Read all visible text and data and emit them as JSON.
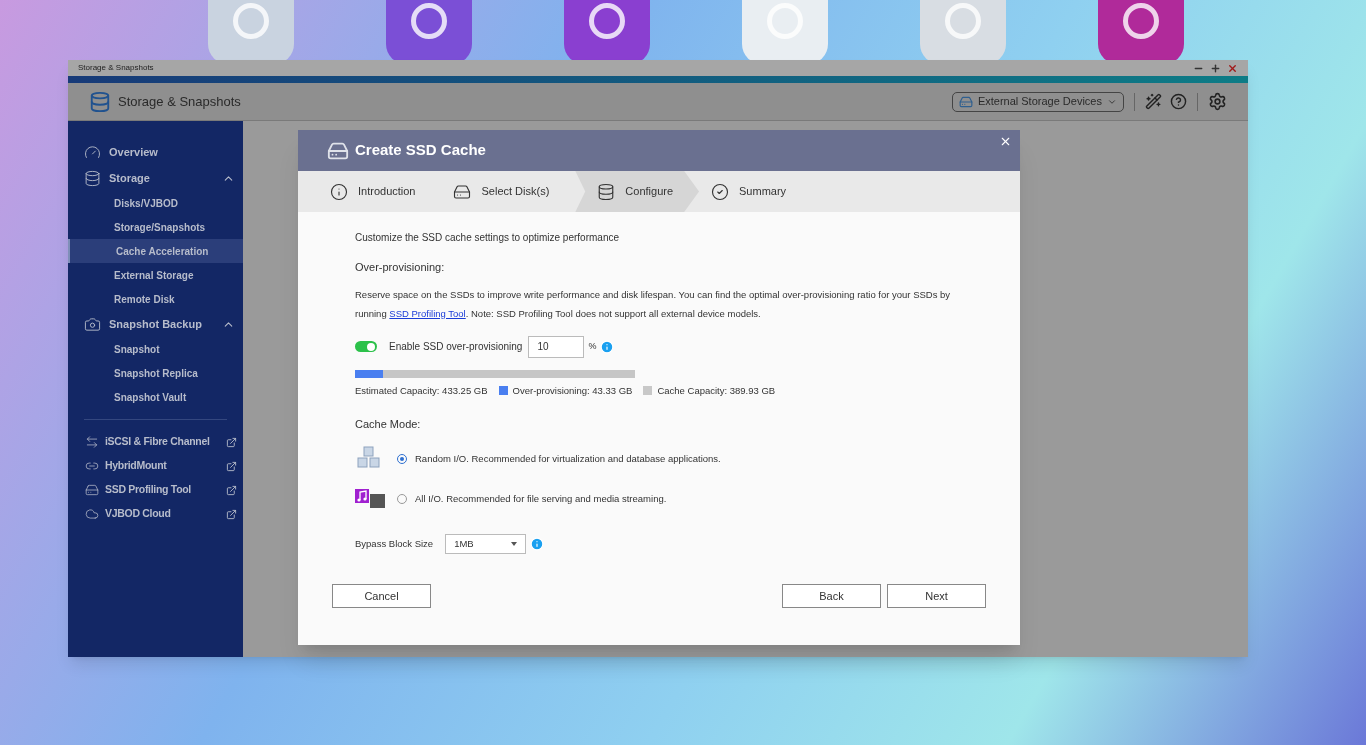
{
  "window": {
    "title": "Storage & Snapshots",
    "app_title": "Storage & Snapshots",
    "device_selector": "External Storage Devices"
  },
  "sidebar": {
    "items": [
      {
        "label": "Overview",
        "kind": "page",
        "selected": false
      },
      {
        "label": "Storage",
        "kind": "group",
        "expanded": true,
        "children": [
          {
            "label": "Disks/VJBOD",
            "selected": false
          },
          {
            "label": "Storage/Snapshots",
            "selected": false
          },
          {
            "label": "Cache Acceleration",
            "selected": true
          },
          {
            "label": "External Storage",
            "selected": false
          },
          {
            "label": "Remote Disk",
            "selected": false
          }
        ]
      },
      {
        "label": "Snapshot Backup",
        "kind": "group",
        "expanded": true,
        "children": [
          {
            "label": "Snapshot",
            "selected": false
          },
          {
            "label": "Snapshot Replica",
            "selected": false
          },
          {
            "label": "Snapshot Vault",
            "selected": false
          }
        ]
      }
    ],
    "external_items": [
      {
        "label": "iSCSI & Fibre Channel"
      },
      {
        "label": "HybridMount"
      },
      {
        "label": "SSD Profiling Tool"
      },
      {
        "label": "VJBOD Cloud"
      }
    ]
  },
  "dialog": {
    "title": "Create SSD Cache",
    "steps": [
      {
        "label": "Introduction",
        "selected": false
      },
      {
        "label": "Select Disk(s)",
        "selected": false
      },
      {
        "label": "Configure",
        "selected": true
      },
      {
        "label": "Summary",
        "selected": false
      }
    ],
    "intro": "Customize the SSD cache settings to optimize performance",
    "over_provisioning": {
      "heading": "Over-provisioning:",
      "text_before": "Reserve space on the SSDs to improve write performance and disk lifespan. You can find the optimal over-provisioning ratio for your SSDs by running ",
      "link": "SSD Profiling Tool",
      "text_after": ". Note: SSD Profiling Tool does not support all external device models.",
      "toggle": {
        "label": "Enable SSD over-provisioning",
        "on": true
      },
      "value": "10",
      "unit": "%",
      "capacity_bar": {
        "level": 0.1
      },
      "estimated": "Estimated Capacity: 433.25 GB",
      "legend": [
        {
          "label": "Over-provisioning: 43.33 GB",
          "color": "#4a7ff0"
        },
        {
          "label": "Cache Capacity: 389.93 GB",
          "color": "#c8c8c8"
        }
      ]
    },
    "cache_mode": {
      "heading": "Cache Mode:",
      "options": [
        {
          "kind": "random",
          "label": "Random I/O. Recommended for virtualization and database applications.",
          "selected": true
        },
        {
          "kind": "all",
          "label": "All I/O. Recommended for file serving and media streaming.",
          "selected": false
        }
      ]
    },
    "bypass": {
      "label": "Bypass Block Size",
      "value": "1MB"
    },
    "buttons": {
      "cancel": "Cancel",
      "back": "Back",
      "next": "Next"
    }
  }
}
